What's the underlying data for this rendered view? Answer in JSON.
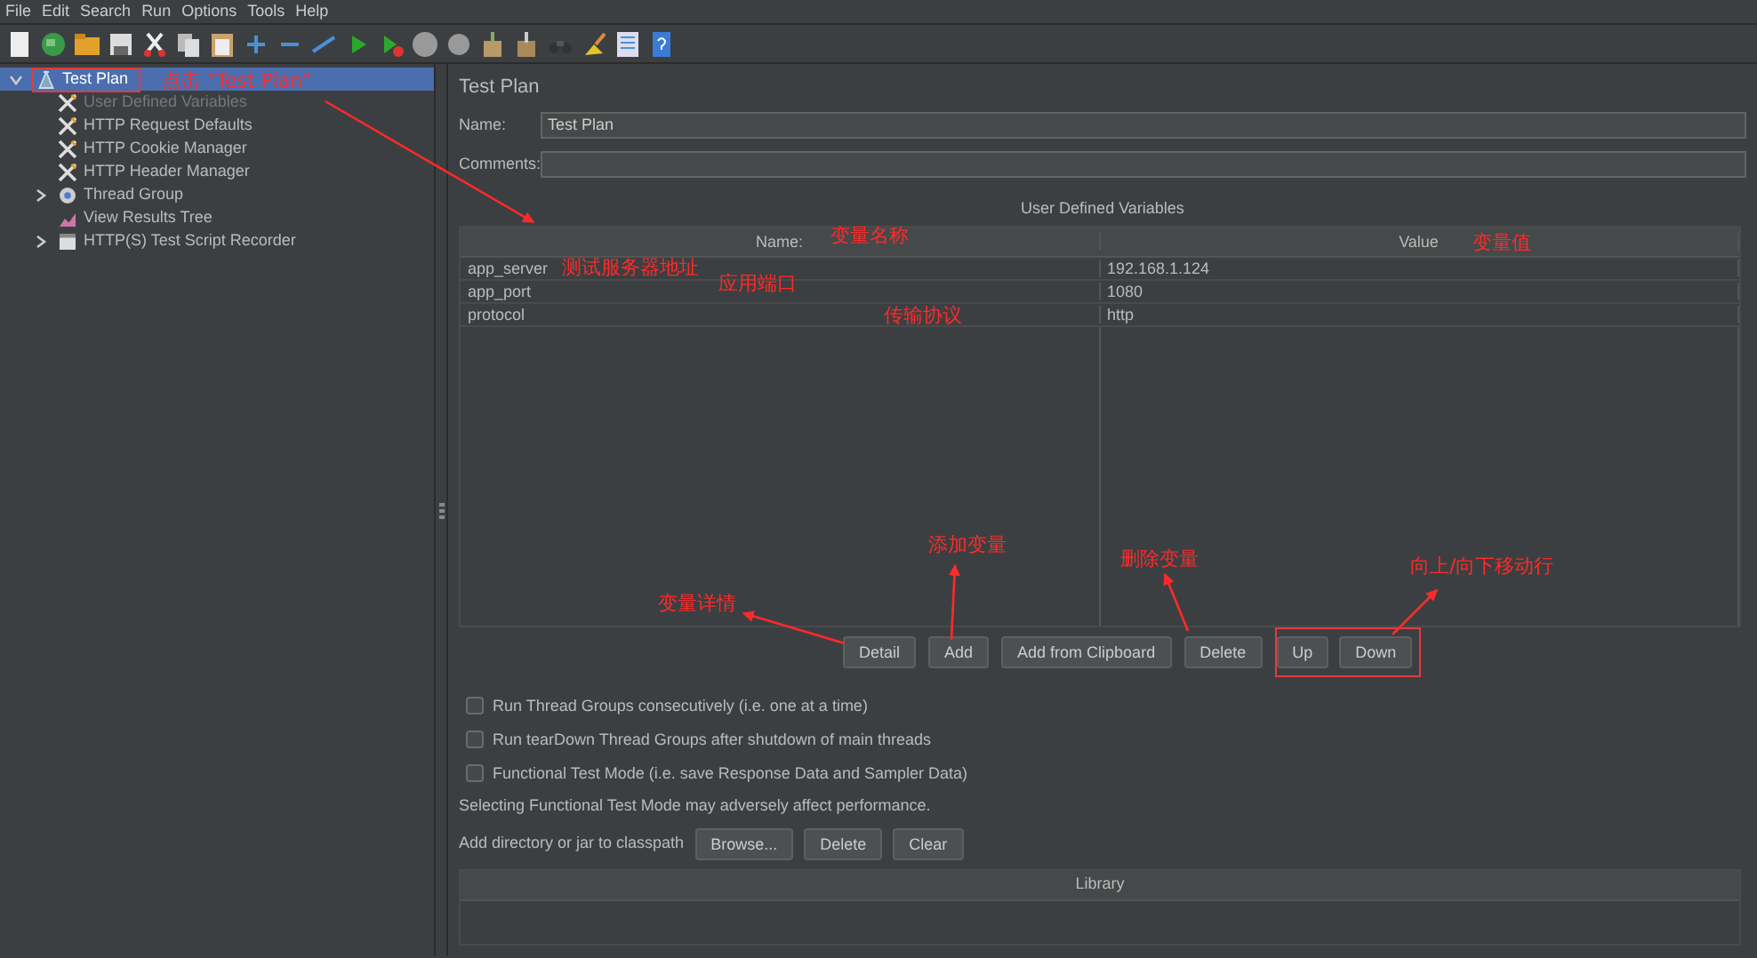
{
  "menu": [
    {
      "label": "File"
    },
    {
      "label": "Edit"
    },
    {
      "label": "Search"
    },
    {
      "label": "Run"
    },
    {
      "label": "Options"
    },
    {
      "label": "Tools"
    },
    {
      "label": "Help"
    }
  ],
  "tree": [
    {
      "label": "Test Plan",
      "kind": "plan",
      "selected": true,
      "expanded": true,
      "children": [
        {
          "label": "User Defined Variables",
          "kind": "config",
          "disabled": true,
          "selected": false
        },
        {
          "label": "HTTP Request Defaults",
          "kind": "config",
          "disabled": false,
          "selected": false
        },
        {
          "label": "HTTP Cookie Manager",
          "kind": "config",
          "disabled": false,
          "selected": false
        },
        {
          "label": "HTTP Header Manager",
          "kind": "config",
          "disabled": false,
          "selected": false
        },
        {
          "label": "Thread Group",
          "kind": "threads",
          "disabled": false,
          "selected": false,
          "expanded": false
        },
        {
          "label": "View Results Tree",
          "kind": "listener",
          "disabled": false,
          "selected": false
        },
        {
          "label": "HTTP(S) Test Script Recorder",
          "kind": "recorder",
          "disabled": false,
          "selected": false,
          "expanded": false
        }
      ]
    }
  ],
  "panel": {
    "title": "Test Plan",
    "name_label": "Name:",
    "name_value": "Test Plan",
    "comments_label": "Comments:",
    "variables": {
      "title": "User Defined Variables",
      "columns": [
        "Name:",
        "Value"
      ],
      "rows": [
        {
          "name": "app_server",
          "value": "192.168.1.124"
        },
        {
          "name": "app_port",
          "value": "1080"
        },
        {
          "name": "protocol",
          "value": "http"
        }
      ],
      "buttons": [
        "Detail",
        "Add",
        "Add from Clipboard",
        "Delete",
        "Up",
        "Down"
      ]
    },
    "options": [
      {
        "label": "Run Thread Groups consecutively (i.e. one at a time)",
        "checked": false
      },
      {
        "label": "Run tearDown Thread Groups after shutdown of main threads",
        "checked": false
      },
      {
        "label": "Functional Test Mode (i.e. save Response Data and Sampler Data)",
        "checked": false
      }
    ],
    "note": "Selecting Functional Test Mode may adversely affect performance.",
    "classpath_label": "Add directory or jar to classpath",
    "classpath_buttons": [
      "Browse...",
      "Delete",
      "Clear"
    ],
    "library_header": "Library"
  },
  "annotations": [
    {
      "text": "点击 \"Test Plan\""
    },
    {
      "text": "变量名称"
    },
    {
      "text": "变量值"
    },
    {
      "text": "测试服务器地址"
    },
    {
      "text": "应用端口"
    },
    {
      "text": "传输协议"
    },
    {
      "text": "添加变量"
    },
    {
      "text": "删除变量"
    },
    {
      "text": "变量详情"
    },
    {
      "text": "向上/向下移动行"
    }
  ]
}
